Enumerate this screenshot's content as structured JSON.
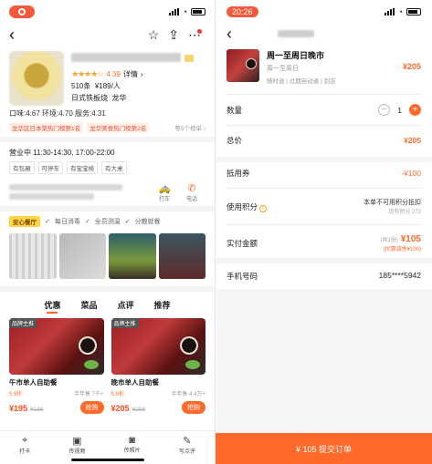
{
  "left": {
    "shop": {
      "rating_score": "4.39",
      "rating_detail_link": "详情",
      "reviews": "510条",
      "avg_price": "¥189/人",
      "category": "日式铁板烧",
      "area": "龙华",
      "scores": "口味:4.67  环境:4.70  服务:4.31",
      "rank_tags": [
        "龙华区日本菜热门榜第1名",
        "龙华美食热门榜第2名"
      ],
      "rank_more": "等5个榜单 ›"
    },
    "hours": "营业中  11:30-14:30, 17:00-22:00",
    "tags": [
      "有包厢",
      "可停车",
      "有宝宝椅",
      "有大桌"
    ],
    "addr_actions": [
      {
        "icon": "taxi-icon",
        "label": "打车",
        "badge": "优惠"
      },
      {
        "icon": "phone-icon",
        "label": "电话"
      }
    ],
    "safety": {
      "badge": "安心餐厅",
      "items": [
        "每日消毒",
        "全员测温",
        "分散就餐"
      ]
    },
    "tabs": [
      "优惠",
      "菜品",
      "点评",
      "推荐"
    ],
    "deals": [
      {
        "badge": "品牌主推",
        "name": "午市单人自助餐",
        "discount": "5.9折",
        "sold": "半年售 7千+",
        "price": "¥195",
        "old_price": "¥198",
        "buy": "抢购"
      },
      {
        "badge": "品牌主推",
        "name": "晚市单人自助餐",
        "discount": "5.9折",
        "sold": "半年售 4.4万+",
        "price": "¥205",
        "old_price": "¥208",
        "buy": "抢购"
      }
    ],
    "bottom_bar": [
      {
        "icon": "pin-icon",
        "label": "打卡"
      },
      {
        "icon": "video-icon",
        "label": "传视频"
      },
      {
        "icon": "camera-icon",
        "label": "传照片"
      },
      {
        "icon": "edit-icon",
        "label": "写点评"
      }
    ]
  },
  "right": {
    "time": "20:26",
    "item": {
      "title": "周一至周日晚市",
      "subtitle": "周一至周日",
      "notes": "随时退 | 过期自动退 | 到店",
      "price": "¥205"
    },
    "quantity_label": "数量",
    "quantity": "1",
    "total_label": "总价",
    "total": "¥205",
    "coupon_label": "抵用券",
    "coupon_value": "-¥100",
    "points_label": "使用积分",
    "points_value": "本单不可用积分抵扣",
    "points_sub": "现有积分 272",
    "pay_label": "实付金额",
    "pay_tag": "(共1份)",
    "pay_amount": "¥105",
    "pay_note": "(优惠减免¥100)",
    "phone_label": "手机号码",
    "phone_value": "185****5942",
    "submit": "¥ 105 提交订单"
  },
  "colors": {
    "accent": "#ff6a2b",
    "red": "#f3593a"
  }
}
